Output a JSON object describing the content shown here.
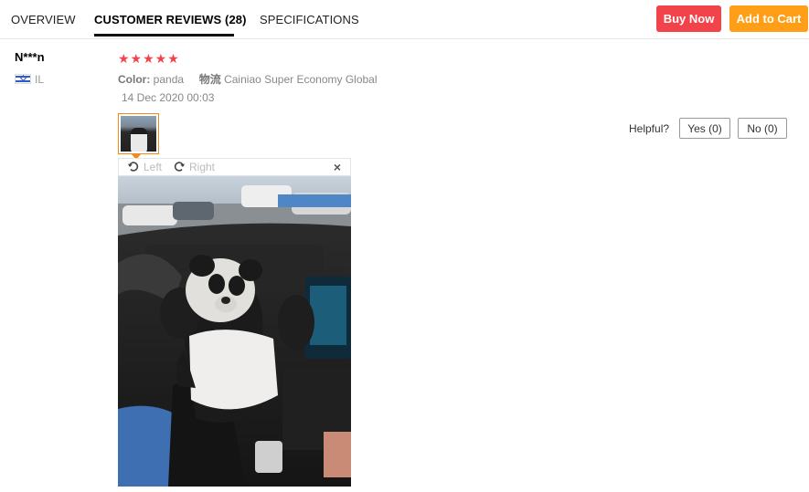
{
  "tabs": [
    {
      "label": "OVERVIEW",
      "active": false
    },
    {
      "label": "CUSTOMER REVIEWS (28)",
      "active": true
    },
    {
      "label": "SPECIFICATIONS",
      "active": false
    }
  ],
  "actions": {
    "buy_now": "Buy Now",
    "add_to_cart": "Add to Cart"
  },
  "colors": {
    "buy_now": "#f2434b",
    "add_to_cart": "#ff9e17",
    "stars": "#f2434b",
    "thumb_border": "#f08b1a"
  },
  "review": {
    "reviewer": "N***n",
    "country": "IL",
    "flag_icon": "israel-flag-icon",
    "rating": 5,
    "stars_text": "★★★★★",
    "color_label": "Color:",
    "color_value": "panda",
    "logistics_label": "物流",
    "logistics_value": "Cainiao Super Economy Global",
    "date": "14 Dec 2020 00:03",
    "helpful_label": "Helpful?",
    "helpful_yes": "Yes (0)",
    "helpful_no": "No (0)"
  },
  "viewer": {
    "rotate_left": "Left",
    "rotate_right": "Right",
    "close": "×"
  }
}
